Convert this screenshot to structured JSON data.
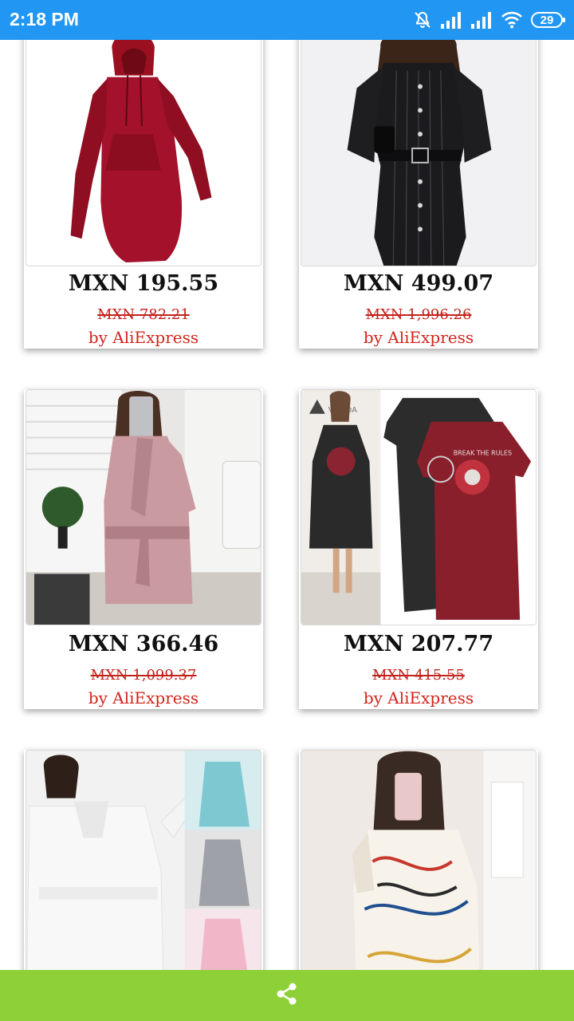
{
  "status_bar": {
    "time": "2:18 PM",
    "battery": "29"
  },
  "colors": {
    "status_bar": "#2196f3",
    "bottom_bar": "#8ed038",
    "old_price": "#c3221c",
    "seller": "#d2231a"
  },
  "products": [
    {
      "price": "MXN 195.55",
      "old_price": "MXN 782.21",
      "seller": "by AliExpress",
      "image": "red-hooded-dress"
    },
    {
      "price": "MXN 499.07",
      "old_price": "MXN 1,996.26",
      "seller": "by AliExpress",
      "image": "black-pinstripe-dress"
    },
    {
      "price": "MXN 366.46",
      "old_price": "MXN 1,099.37",
      "seller": "by AliExpress",
      "image": "pink-wrap-dress"
    },
    {
      "price": "MXN 207.77",
      "old_price": "MXN 415.55",
      "seller": "by AliExpress",
      "image": "rose-print-tshirt-dress"
    },
    {
      "price": "",
      "old_price": "",
      "seller": "",
      "image": "white-hooded-dress"
    },
    {
      "price": "",
      "old_price": "",
      "seller": "",
      "image": "printed-shirt-dress"
    }
  ],
  "bottom_bar": {
    "icon": "share-icon"
  }
}
